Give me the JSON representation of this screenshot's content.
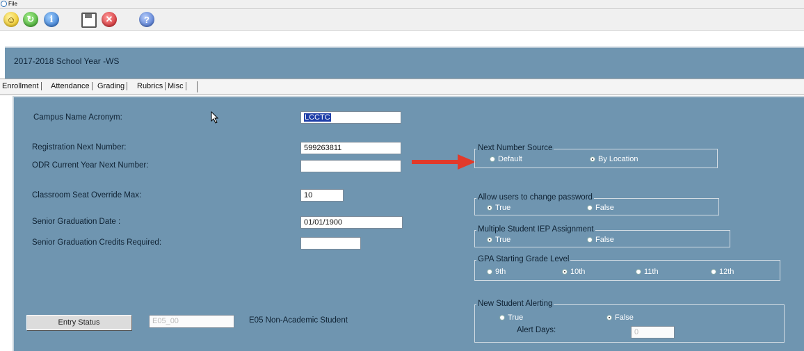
{
  "menubar": {
    "file_label": "File"
  },
  "toolbar": {
    "buttons": [
      "smiley-icon",
      "refresh-icon",
      "info-icon",
      "save-icon",
      "cancel-icon",
      "help-icon"
    ]
  },
  "header": {
    "school_year": "2017-2018 School Year -WS"
  },
  "tabs": [
    {
      "label": "Enrollment",
      "selected": true
    },
    {
      "label": "Attendance"
    },
    {
      "label": "Grading"
    },
    {
      "label": "Rubrics"
    },
    {
      "label": "Misc"
    }
  ],
  "form": {
    "campus_label": "Campus Name Acronym:",
    "campus_value": "LCCTC",
    "reg_label": "Registration Next Number:",
    "reg_value": "599263811",
    "odr_label": "ODR Current Year Next Number:",
    "odr_value": "",
    "seat_label": "Classroom Seat Override Max:",
    "seat_value": "10",
    "grad_date_label": "Senior Graduation Date :",
    "grad_date_value": "01/01/1900",
    "grad_credits_label": "Senior Graduation Credits Required:",
    "grad_credits_value": ""
  },
  "next_number_source": {
    "title": "Next Number Source",
    "options": [
      "Default",
      "By Location"
    ],
    "selected": "By Location"
  },
  "allow_password": {
    "title": "Allow users to change  password",
    "options": [
      "True",
      "False"
    ],
    "selected": "True"
  },
  "multiple_iep": {
    "title": "Multiple Student IEP Assignment",
    "options": [
      "True",
      "False"
    ],
    "selected": "True"
  },
  "gpa_start": {
    "title": "GPA Starting Grade Level",
    "options": [
      "9th",
      "10th",
      "11th",
      "12th"
    ],
    "selected": "10th"
  },
  "new_student_alerting": {
    "title": "New Student Alerting",
    "options": [
      "True",
      "False"
    ],
    "selected": "False",
    "alert_days_label": "Alert Days:",
    "alert_days_value": "0"
  },
  "entry_status": {
    "button_label": "Entry Status",
    "code_value": "E05_00",
    "description": "E05 Non-Academic Student"
  },
  "colors": {
    "panel": "#6f95b0",
    "arrow": "#e23a2a",
    "selection": "#1f3fa8"
  }
}
